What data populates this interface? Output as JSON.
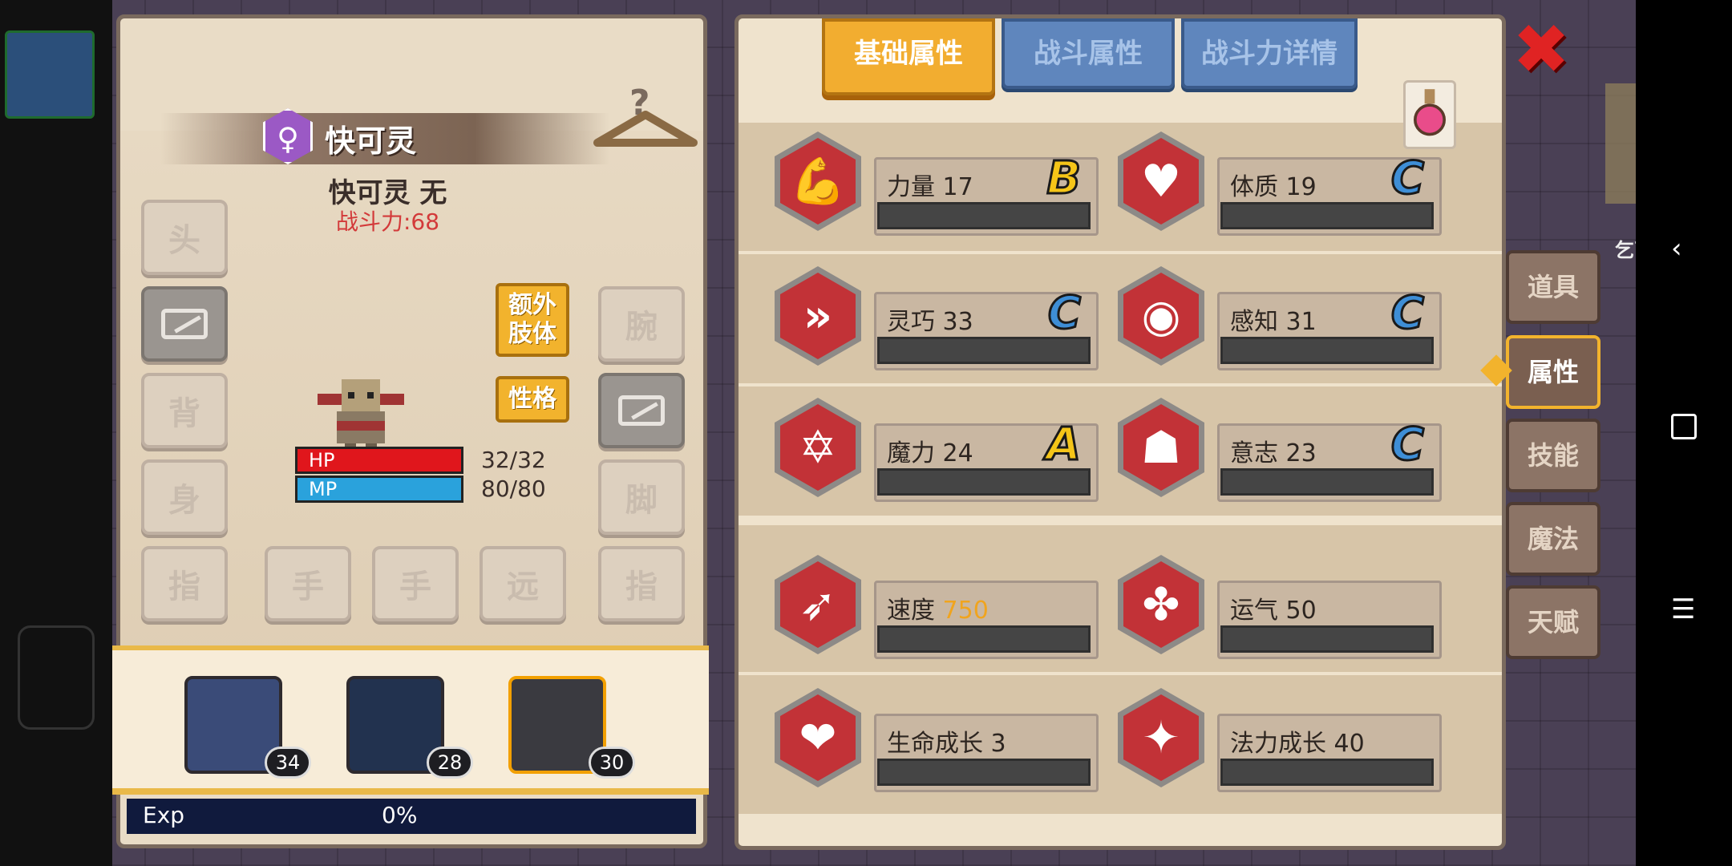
{
  "character": {
    "gender_symbol": "♀",
    "name": "快可灵",
    "subtitle": "快可灵 无",
    "power": "战斗力:68",
    "hp_label": "HP",
    "hp_value": "32/32",
    "mp_label": "MP",
    "mp_value": "80/80",
    "hp_fraction": 1,
    "mp_fraction": 1
  },
  "equip_slots": {
    "head": "头",
    "back": "背",
    "body": "身",
    "ring_left": "指",
    "hand1": "手",
    "hand2": "手",
    "ranged": "远",
    "ring_right": "指",
    "wrist": "腕",
    "feet": "脚"
  },
  "buttons": {
    "extra_limbs": "额外\n肢体",
    "personality": "性格"
  },
  "team": [
    {
      "level": "34"
    },
    {
      "level": "28"
    },
    {
      "level": "30",
      "selected": true
    }
  ],
  "exp": {
    "label": "Exp",
    "value": "0%"
  },
  "tabs": [
    "基础属性",
    "战斗属性",
    "战斗力详情"
  ],
  "stats": [
    {
      "name": "力量",
      "value": "17",
      "grade": "B",
      "icon": "strength-arm-icon"
    },
    {
      "name": "体质",
      "value": "19",
      "grade": "C",
      "icon": "constitution-body-icon"
    },
    {
      "name": "灵巧",
      "value": "33",
      "grade": "C",
      "icon": "dexterity-runner-icon"
    },
    {
      "name": "感知",
      "value": "31",
      "grade": "C",
      "icon": "perception-eye-icon"
    },
    {
      "name": "魔力",
      "value": "24",
      "grade": "A",
      "icon": "magic-hexagram-icon"
    },
    {
      "name": "意志",
      "value": "23",
      "grade": "C",
      "icon": "will-head-icon"
    },
    {
      "name": "速度",
      "value": "750",
      "grade": "",
      "icon": "speed-wing-icon"
    },
    {
      "name": "运气",
      "value": "50",
      "grade": "",
      "icon": "luck-clover-icon"
    },
    {
      "name": "生命成长",
      "value": "3",
      "grade": "",
      "icon": "life-growth-heart-icon"
    },
    {
      "name": "法力成长",
      "value": "40",
      "grade": "",
      "icon": "mana-growth-icon"
    }
  ],
  "side_menu": [
    "道具",
    "属性",
    "技能",
    "魔法",
    "天赋"
  ],
  "map_label": "乞丐洞窟",
  "colors": {
    "accent": "#f2b32d",
    "stat_red": "#c23237",
    "grade_gold": "#f5c518",
    "grade_blue": "#3e8ed6"
  }
}
